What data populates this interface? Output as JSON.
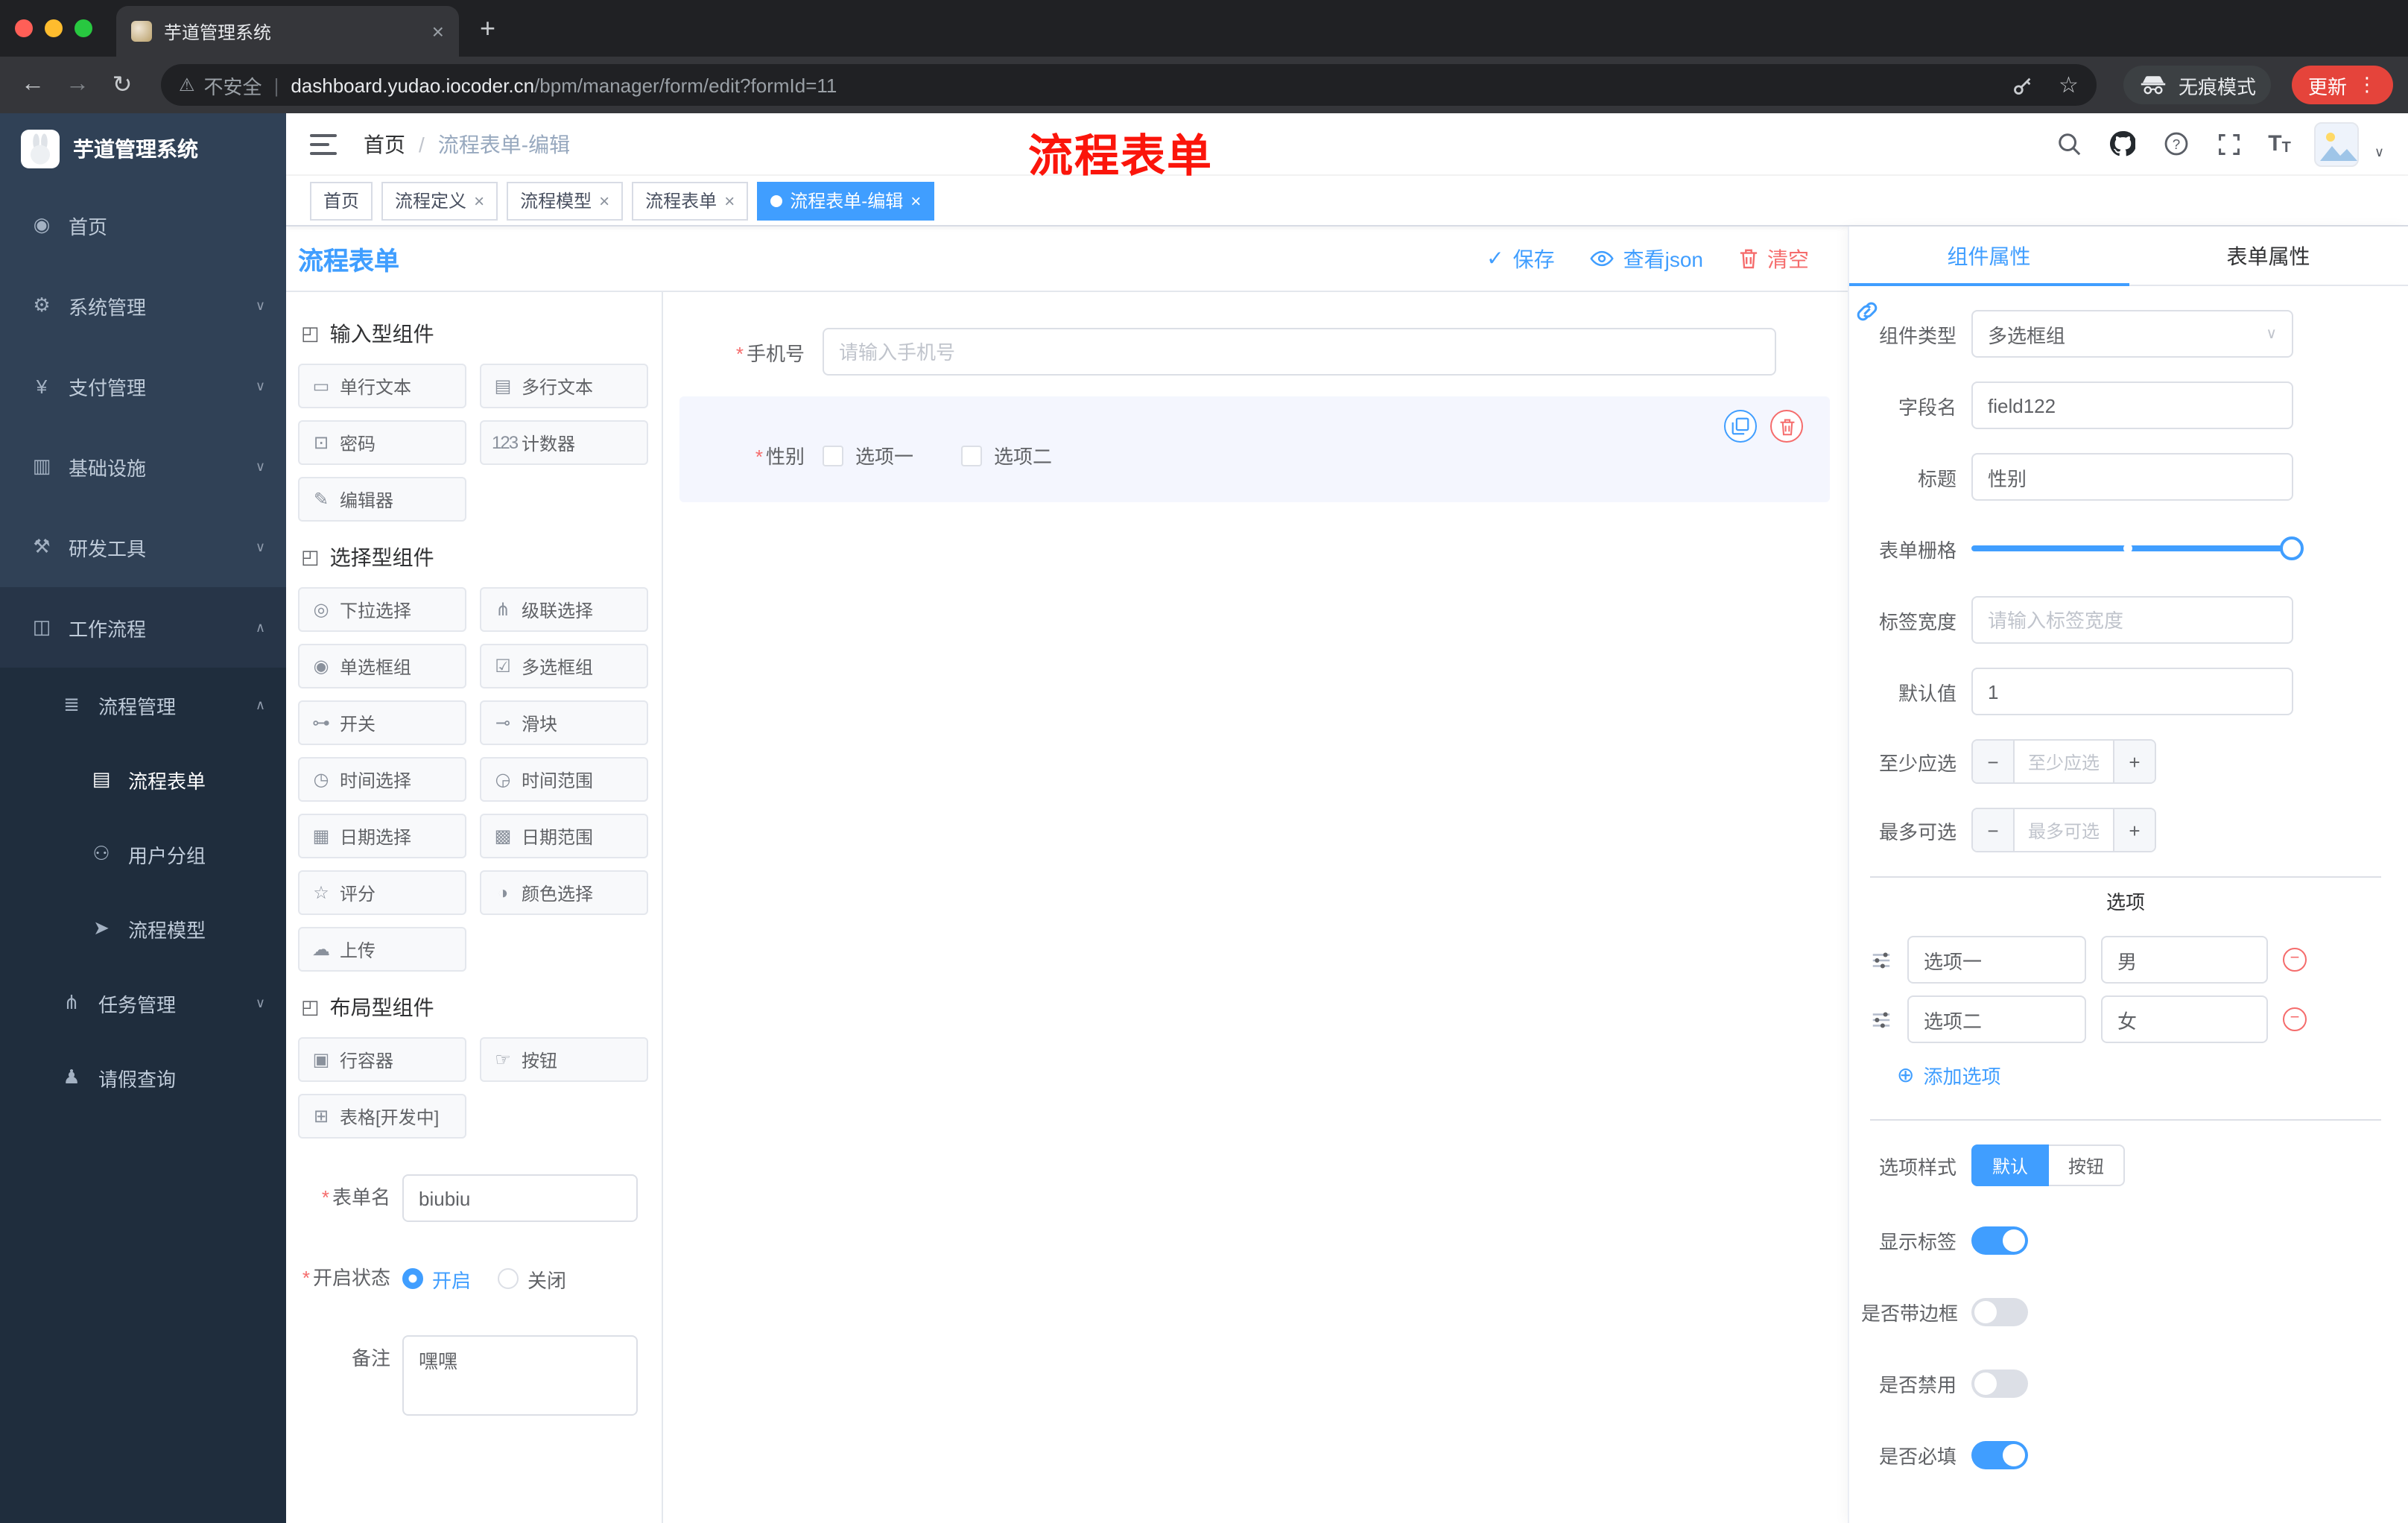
{
  "icons": {
    "back": "←",
    "forward": "→",
    "reload": "↻",
    "warning": "⚠",
    "pipe": "|",
    "star": "☆",
    "dots": "⋮",
    "chevron_down": "∨",
    "chevron_up": "∧",
    "plus": "+",
    "close": "×",
    "minus": "−",
    "check": "✓",
    "asterisk": "*",
    "slash": "/",
    "add_circle": "⊕",
    "question": "?",
    "active_dot": "●",
    "font_big": "T",
    "font_small": "T"
  },
  "browser": {
    "tab_title": "芋道管理系统",
    "security_label": "不安全",
    "url_domain": "dashboard.yudao.iocoder.cn",
    "url_path": "/bpm/manager/form/edit?formId=11",
    "incognito_label": "无痕模式",
    "update_label": "更新"
  },
  "sidebar": {
    "logo_title": "芋道管理系统",
    "items": [
      {
        "label": "首页",
        "glyph": "◉",
        "icon": "dashboard-icon"
      },
      {
        "label": "系统管理",
        "glyph": "⚙",
        "icon": "gear-icon"
      },
      {
        "label": "支付管理",
        "glyph": "¥",
        "icon": "yen-icon"
      },
      {
        "label": "基础设施",
        "glyph": "▥",
        "icon": "infrastructure-icon"
      },
      {
        "label": "研发工具",
        "glyph": "⚒",
        "icon": "tools-icon"
      },
      {
        "label": "工作流程",
        "glyph": "◫",
        "icon": "briefcase-icon"
      },
      {
        "label": "流程管理",
        "glyph": "≣",
        "icon": "list-icon"
      },
      {
        "label": "流程表单",
        "glyph": "▤",
        "icon": "form-icon"
      },
      {
        "label": "用户分组",
        "glyph": "⚇",
        "icon": "users-icon"
      },
      {
        "label": "流程模型",
        "glyph": "➤",
        "icon": "model-icon"
      },
      {
        "label": "任务管理",
        "glyph": "⋔",
        "icon": "tasks-icon"
      },
      {
        "label": "请假查询",
        "glyph": "♟",
        "icon": "person-icon"
      }
    ]
  },
  "header": {
    "breadcrumb_home": "首页",
    "breadcrumb_current": "流程表单-编辑",
    "overlay_title": "流程表单"
  },
  "tags": {
    "items": [
      {
        "label": "首页"
      },
      {
        "label": "流程定义"
      },
      {
        "label": "流程模型"
      },
      {
        "label": "流程表单"
      },
      {
        "label": "流程表单-编辑"
      }
    ]
  },
  "designer": {
    "title": "流程表单",
    "actions": {
      "save": "保存",
      "view_json": "查看json",
      "clear": "清空"
    },
    "palette": {
      "group_glyph": "◰",
      "groups": [
        {
          "title": "输入型组件",
          "items": [
            {
              "label": "单行文本",
              "glyph": "▭",
              "icon": "text-input-icon"
            },
            {
              "label": "多行文本",
              "glyph": "▤",
              "icon": "textarea-icon"
            },
            {
              "label": "密码",
              "glyph": "⊡",
              "icon": "lock-icon"
            },
            {
              "label": "计数器",
              "glyph": "123",
              "icon": "counter-icon"
            },
            {
              "label": "编辑器",
              "glyph": "✎",
              "icon": "editor-icon"
            }
          ]
        },
        {
          "title": "选择型组件",
          "items": [
            {
              "label": "下拉选择",
              "glyph": "◎",
              "icon": "select-icon"
            },
            {
              "label": "级联选择",
              "glyph": "⋔",
              "icon": "cascader-icon"
            },
            {
              "label": "单选框组",
              "glyph": "◉",
              "icon": "radio-group-icon"
            },
            {
              "label": "多选框组",
              "glyph": "☑",
              "icon": "checkbox-group-icon"
            },
            {
              "label": "开关",
              "glyph": "⊶",
              "icon": "switch-icon"
            },
            {
              "label": "滑块",
              "glyph": "⊸",
              "icon": "slider-icon"
            },
            {
              "label": "时间选择",
              "glyph": "◷",
              "icon": "time-icon"
            },
            {
              "label": "时间范围",
              "glyph": "◶",
              "icon": "time-range-icon"
            },
            {
              "label": "日期选择",
              "glyph": "▦",
              "icon": "date-icon"
            },
            {
              "label": "日期范围",
              "glyph": "▩",
              "icon": "date-range-icon"
            },
            {
              "label": "评分",
              "glyph": "☆",
              "icon": "rate-icon"
            },
            {
              "label": "颜色选择",
              "glyph": "◑",
              "icon": "color-icon"
            },
            {
              "label": "上传",
              "glyph": "☁",
              "icon": "upload-icon"
            }
          ]
        },
        {
          "title": "布局型组件",
          "items": [
            {
              "label": "行容器",
              "glyph": "▣",
              "icon": "row-container-icon"
            },
            {
              "label": "按钮",
              "glyph": "☞",
              "icon": "button-icon"
            },
            {
              "label": "表格[开发中]",
              "glyph": "⊞",
              "icon": "table-icon"
            }
          ]
        }
      ]
    },
    "meta": {
      "name_label": "表单名",
      "name_value": "biubiu",
      "status_label": "开启状态",
      "status_on": "开启",
      "status_off": "关闭",
      "remark_label": "备注",
      "remark_value": "嘿嘿"
    },
    "canvas": {
      "phone_label": "手机号",
      "phone_placeholder": "请输入手机号",
      "gender_label": "性别",
      "gender_option1": "选项一",
      "gender_option2": "选项二"
    }
  },
  "props": {
    "tab_component": "组件属性",
    "tab_form": "表单属性",
    "component_type_label": "组件类型",
    "component_type_value": "多选框组",
    "field_name_label": "字段名",
    "field_name_value": "field122",
    "title_label": "标题",
    "title_value": "性别",
    "grid_label": "表单栅格",
    "label_width_label": "标签宽度",
    "label_width_placeholder": "请输入标签宽度",
    "default_label": "默认值",
    "default_value": "1",
    "min_label": "至少应选",
    "min_placeholder": "至少应选",
    "max_label": "最多可选",
    "max_placeholder": "最多可选",
    "options_divider": "选项",
    "options": [
      {
        "name": "选项一",
        "value": "男"
      },
      {
        "name": "选项二",
        "value": "女"
      }
    ],
    "add_option": "添加选项",
    "style_label": "选项样式",
    "style_default": "默认",
    "style_button": "按钮",
    "toggle_show_label": "显示标签",
    "toggle_border": "是否带边框",
    "toggle_disabled": "是否禁用",
    "toggle_required": "是否必填"
  },
  "colors": {
    "accent": "#409eff",
    "danger": "#f56c6c",
    "sidebar_bg": "#304156",
    "sidebar_sub_bg": "#1f2d3d",
    "update_badge": "#e5443b"
  }
}
